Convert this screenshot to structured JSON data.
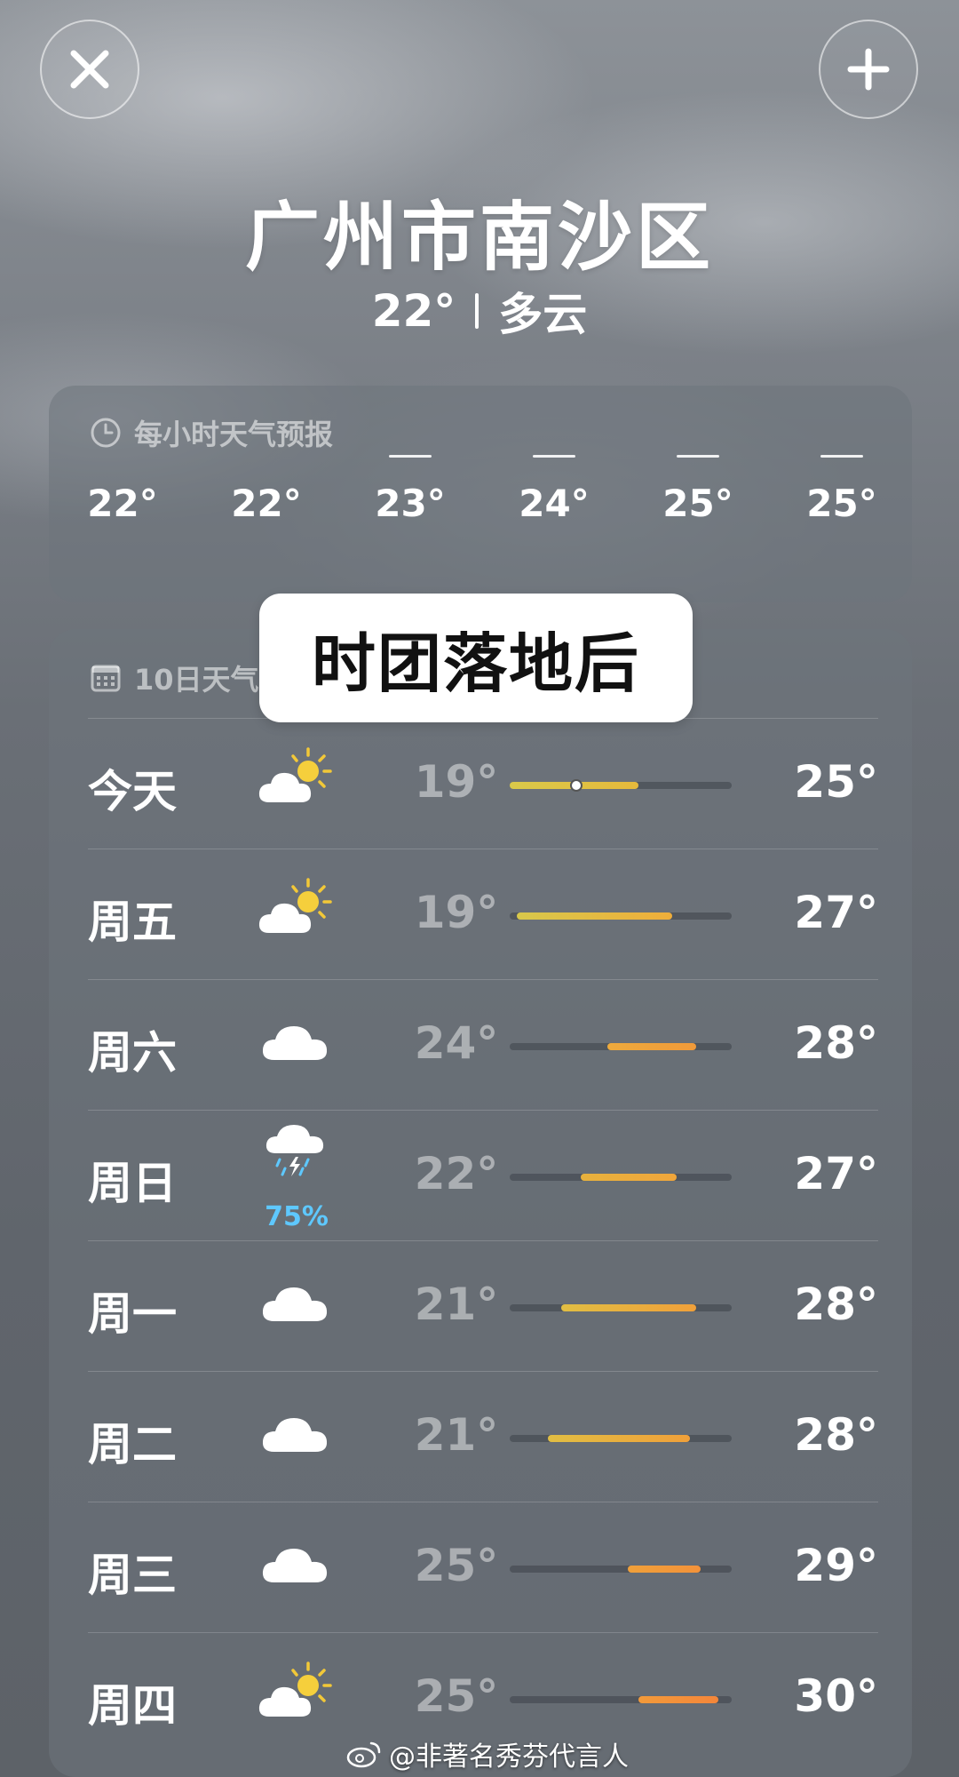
{
  "header": {
    "city": "广州市南沙区",
    "current_temp": "22°",
    "condition": "多云"
  },
  "hourly": {
    "title": "每小时天气预报",
    "temps": [
      "22°",
      "22°",
      "23°",
      "24°",
      "25°",
      "25°"
    ]
  },
  "daily": {
    "title": "10日天气",
    "rows": [
      {
        "day": "今天",
        "icon": "partly-cloudy-sun-icon",
        "precip": "",
        "low": "19°",
        "high": "25°",
        "range": [
          0.0,
          0.58
        ],
        "color_from": "#d9c94a",
        "color_to": "#e6b93c",
        "current": 0.3
      },
      {
        "day": "周五",
        "icon": "partly-cloudy-sun-icon",
        "precip": "",
        "low": "19°",
        "high": "27°",
        "range": [
          0.03,
          0.73
        ],
        "color_from": "#d8c84b",
        "color_to": "#efae3a"
      },
      {
        "day": "周六",
        "icon": "cloud-icon",
        "precip": "",
        "low": "24°",
        "high": "28°",
        "range": [
          0.44,
          0.84
        ],
        "color_from": "#eeaa3c",
        "color_to": "#f09a3a"
      },
      {
        "day": "周日",
        "icon": "thunder-rain-icon",
        "precip": "75%",
        "low": "22°",
        "high": "27°",
        "range": [
          0.32,
          0.75
        ],
        "color_from": "#e8b23d",
        "color_to": "#f0a63b"
      },
      {
        "day": "周一",
        "icon": "cloud-icon",
        "precip": "",
        "low": "21°",
        "high": "28°",
        "range": [
          0.23,
          0.84
        ],
        "color_from": "#e1be43",
        "color_to": "#f0a03a"
      },
      {
        "day": "周二",
        "icon": "cloud-icon",
        "precip": "",
        "low": "21°",
        "high": "28°",
        "range": [
          0.17,
          0.81
        ],
        "color_from": "#e1be43",
        "color_to": "#f0a03a"
      },
      {
        "day": "周三",
        "icon": "cloud-icon",
        "precip": "",
        "low": "25°",
        "high": "29°",
        "range": [
          0.53,
          0.86
        ],
        "color_from": "#f0a03a",
        "color_to": "#f3923a"
      },
      {
        "day": "周四",
        "icon": "partly-cloudy-sun-icon",
        "precip": "",
        "low": "25°",
        "high": "30°",
        "range": [
          0.58,
          0.94
        ],
        "color_from": "#f29a3a",
        "color_to": "#f4863a"
      }
    ]
  },
  "overlay": {
    "text": "时团落地后"
  },
  "watermark": {
    "text": "@非著名秀芬代言人"
  }
}
